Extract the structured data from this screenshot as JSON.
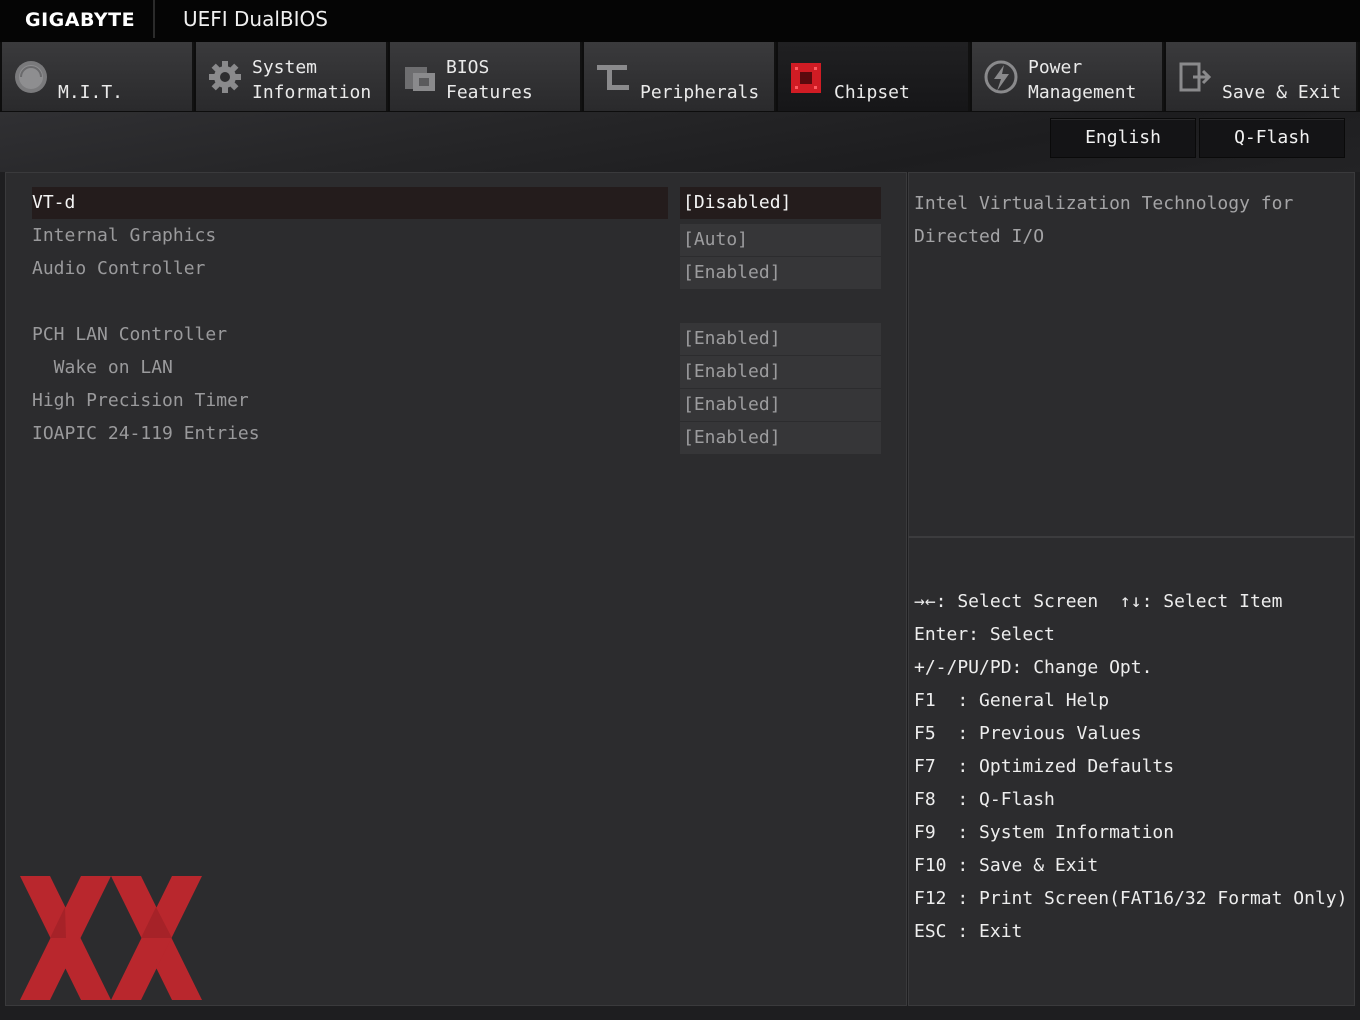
{
  "header": {
    "brand": "GIGABYTE",
    "title": "UEFI DualBIOS"
  },
  "tabs": [
    {
      "label": "M.I.T.",
      "icon": "gauge-icon"
    },
    {
      "label": "System\nInformation",
      "icon": "gear-icon"
    },
    {
      "label": "BIOS\nFeatures",
      "icon": "bios-chip-icon"
    },
    {
      "label": "Peripherals",
      "icon": "usb-plug-icon"
    },
    {
      "label": "Chipset",
      "icon": "chipset-icon",
      "active": true
    },
    {
      "label": "Power\nManagement",
      "icon": "power-bolt-icon"
    },
    {
      "label": "Save & Exit",
      "icon": "exit-door-icon"
    }
  ],
  "toolbar": {
    "english": "English",
    "qflash": "Q-Flash"
  },
  "settings": [
    {
      "label": "VT-d",
      "value": "[Disabled]",
      "selected": true
    },
    {
      "label": "Internal Graphics",
      "value": "[Auto]"
    },
    {
      "label": "Audio Controller",
      "value": "[Enabled]"
    },
    {
      "label": "PCH LAN Controller",
      "value": "[Enabled]"
    },
    {
      "label": "  Wake on LAN",
      "value": "[Enabled]"
    },
    {
      "label": "High Precision Timer",
      "value": "[Enabled]"
    },
    {
      "label": "IOAPIC 24-119 Entries",
      "value": "[Enabled]"
    }
  ],
  "help_text": {
    "line1": "Intel Virtualization Technology for",
    "line2": "Directed I/O"
  },
  "key_help": [
    "→←: Select Screen  ↑↓: Select Item",
    "Enter: Select",
    "+/-/PU/PD: Change Opt.",
    "F1  : General Help",
    "F5  : Previous Values",
    "F7  : Optimized Defaults",
    "F8  : Q-Flash",
    "F9  : System Information",
    "F10 : Save & Exit",
    "F12 : Print Screen(FAT16/32 Format Only)",
    "ESC : Exit"
  ],
  "colors": {
    "accent_red": "#c1272d",
    "selected_bg": "#241c1c",
    "panel_bg": "#2c2c2e"
  }
}
